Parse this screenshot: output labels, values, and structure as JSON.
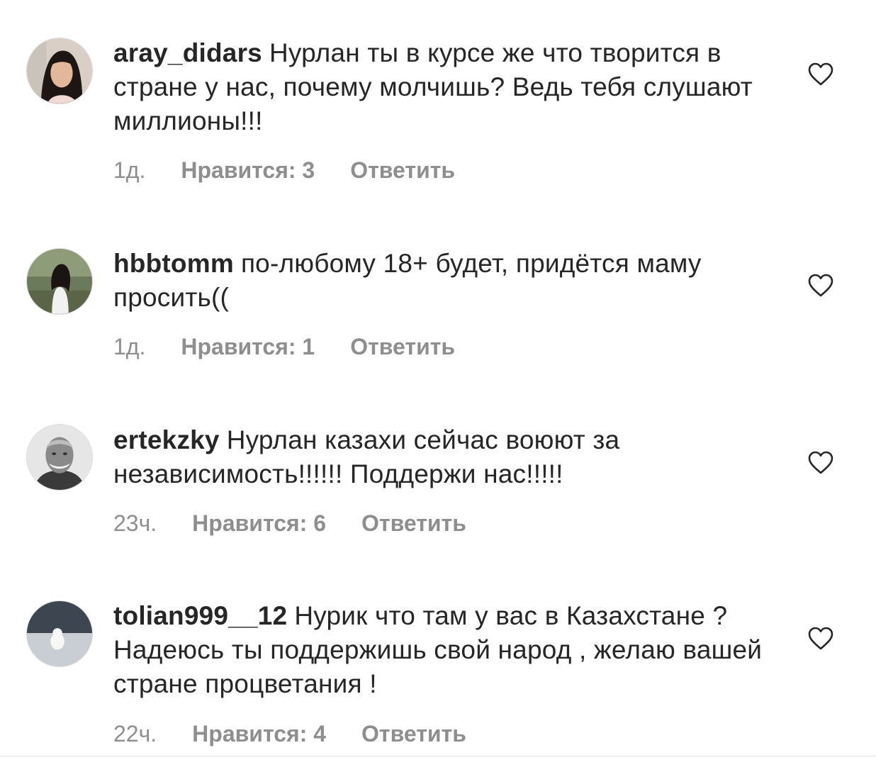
{
  "comments": [
    {
      "username": "aray_didars",
      "text": "Нурлан ты в курсе же что творится в стране у нас, почему молчишь? Ведь тебя слушают миллионы!!!",
      "time": "1д.",
      "likes": "Нравится: 3",
      "reply": "Ответить"
    },
    {
      "username": "hbbtomm",
      "text": "по-любому 18+ будет, придётся маму просить((",
      "time": "1д.",
      "likes": "Нравится: 1",
      "reply": "Ответить"
    },
    {
      "username": "ertekzky",
      "text": "Нурлан казахи сейчас воюют за независимость!!!!!! Поддержи нас!!!!!",
      "time": "23ч.",
      "likes": "Нравится: 6",
      "reply": "Ответить"
    },
    {
      "username": "tolian999__12",
      "text": "Нурик что там у вас в Казахстане ? Надеюсь ты поддержишь свой народ , желаю вашей стране процветания !",
      "time": "22ч.",
      "likes": "Нравится: 4",
      "reply": "Ответить"
    }
  ],
  "icons": {
    "like": "heart-outline-icon"
  },
  "colors": {
    "text": "#262626",
    "secondary": "#8e8e8e",
    "divider": "#efefef"
  }
}
